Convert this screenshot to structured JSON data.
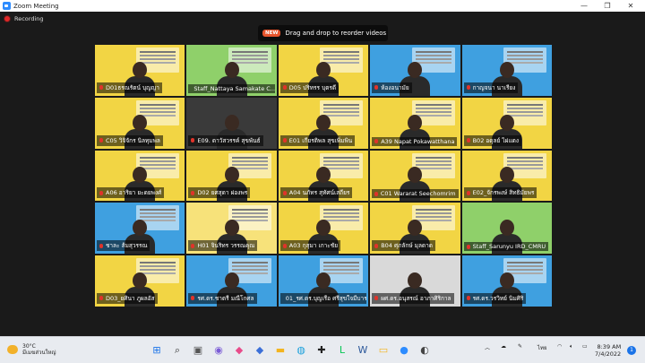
{
  "window": {
    "title": "Zoom Meeting",
    "controls": [
      "minimize",
      "maximize",
      "close"
    ]
  },
  "recording": {
    "label": "Recording"
  },
  "banner": {
    "badge": "NEW",
    "text": "Drag and drop to reorder videos"
  },
  "participants": [
    {
      "name": "D01ธรณรัตน์ บุญญา",
      "bg": "#f2d544",
      "poster": true
    },
    {
      "name": "Staff_Nattaya Samakate C...",
      "bg": "#8fd06a",
      "poster": true
    },
    {
      "name": "D05 ปริทรร บุตรดี",
      "bg": "#f2d544",
      "poster": true
    },
    {
      "name": "ห้องอนามัย",
      "bg": "#3fa0e0",
      "poster": true
    },
    {
      "name": "กาญจนา นาเรียง",
      "bg": "#3fa0e0",
      "poster": true
    },
    {
      "name": "C05 วิจิจักร นิลทุมพล",
      "bg": "#f2d544",
      "poster": true
    },
    {
      "name": "E09. ดาวัสวรรค์ สุขพันธ์",
      "bg": "#3a3a3a",
      "poster": false
    },
    {
      "name": "E01 เกียรติพล สุขเพิ่มพิน",
      "bg": "#f2d544",
      "poster": true
    },
    {
      "name": "A39 Napat Pokawatthana",
      "bg": "#f2d544",
      "poster": true
    },
    {
      "name": "B02 อดุลย์ ไผ่แดง",
      "bg": "#f2d544",
      "poster": true
    },
    {
      "name": "A06 อาริยา ยะดยพงศ์",
      "bg": "#f2d544",
      "poster": true
    },
    {
      "name": "D02 ยศสุดา ผ่องพร",
      "bg": "#f2d544",
      "poster": true
    },
    {
      "name": "A04 นภัทร สุทัศน์เสถียร",
      "bg": "#f2d544",
      "poster": true
    },
    {
      "name": "C01 Wararat Seechomrim",
      "bg": "#f2d544",
      "poster": true
    },
    {
      "name": "E02_จักรพงษ์ สิทธิมัยพร",
      "bg": "#f2d544",
      "poster": true
    },
    {
      "name": "ชาละ ส้มสุวรรณ",
      "bg": "#3fa0e0",
      "poster": true
    },
    {
      "name": "H01 จินริทร วรรณคุณ",
      "bg": "#f7e27a",
      "poster": true
    },
    {
      "name": "A03 กุสุมา เกาะชัย",
      "bg": "#f2d544",
      "poster": true
    },
    {
      "name": "B04 ศุภลักษ์ มุลดาด",
      "bg": "#f2d544",
      "poster": true
    },
    {
      "name": "Staff_Sarunyu IRD_CMRU",
      "bg": "#8fd06a",
      "poster": false
    },
    {
      "name": "D03_ยศินา ภูผลอัส",
      "bg": "#f2d544",
      "poster": true
    },
    {
      "name": "รศ.ดร.ชาตรี มณีโกศล",
      "bg": "#3fa0e0",
      "poster": true
    },
    {
      "name": "01_รศ.ดร.บุญเรือ ศรีสุขใจมีบาร...",
      "bg": "#3fa0e0",
      "poster": true
    },
    {
      "name": "ผศ.ดร.อนุสรณ์ อาภาศิริกาล",
      "bg": "#d9d9d9",
      "poster": false
    },
    {
      "name": "รศ.ดร.วรวิทย์ นิมศิริ",
      "bg": "#3fa0e0",
      "poster": true
    }
  ],
  "taskbar": {
    "weather_temp": "30°C",
    "weather_desc": "มีเมฆส่วนใหญ่",
    "language": "ไทย",
    "time": "8:39 AM",
    "date": "7/4/2022",
    "notifications": "1",
    "icons": [
      "windows-start-icon",
      "search-icon",
      "task-view-icon",
      "chat-icon",
      "app-icon-1",
      "app-icon-2",
      "file-explorer-icon",
      "edge-icon",
      "app-icon-3",
      "line-icon",
      "word-icon",
      "folder-icon",
      "zoom-icon",
      "app-icon-4"
    ]
  }
}
